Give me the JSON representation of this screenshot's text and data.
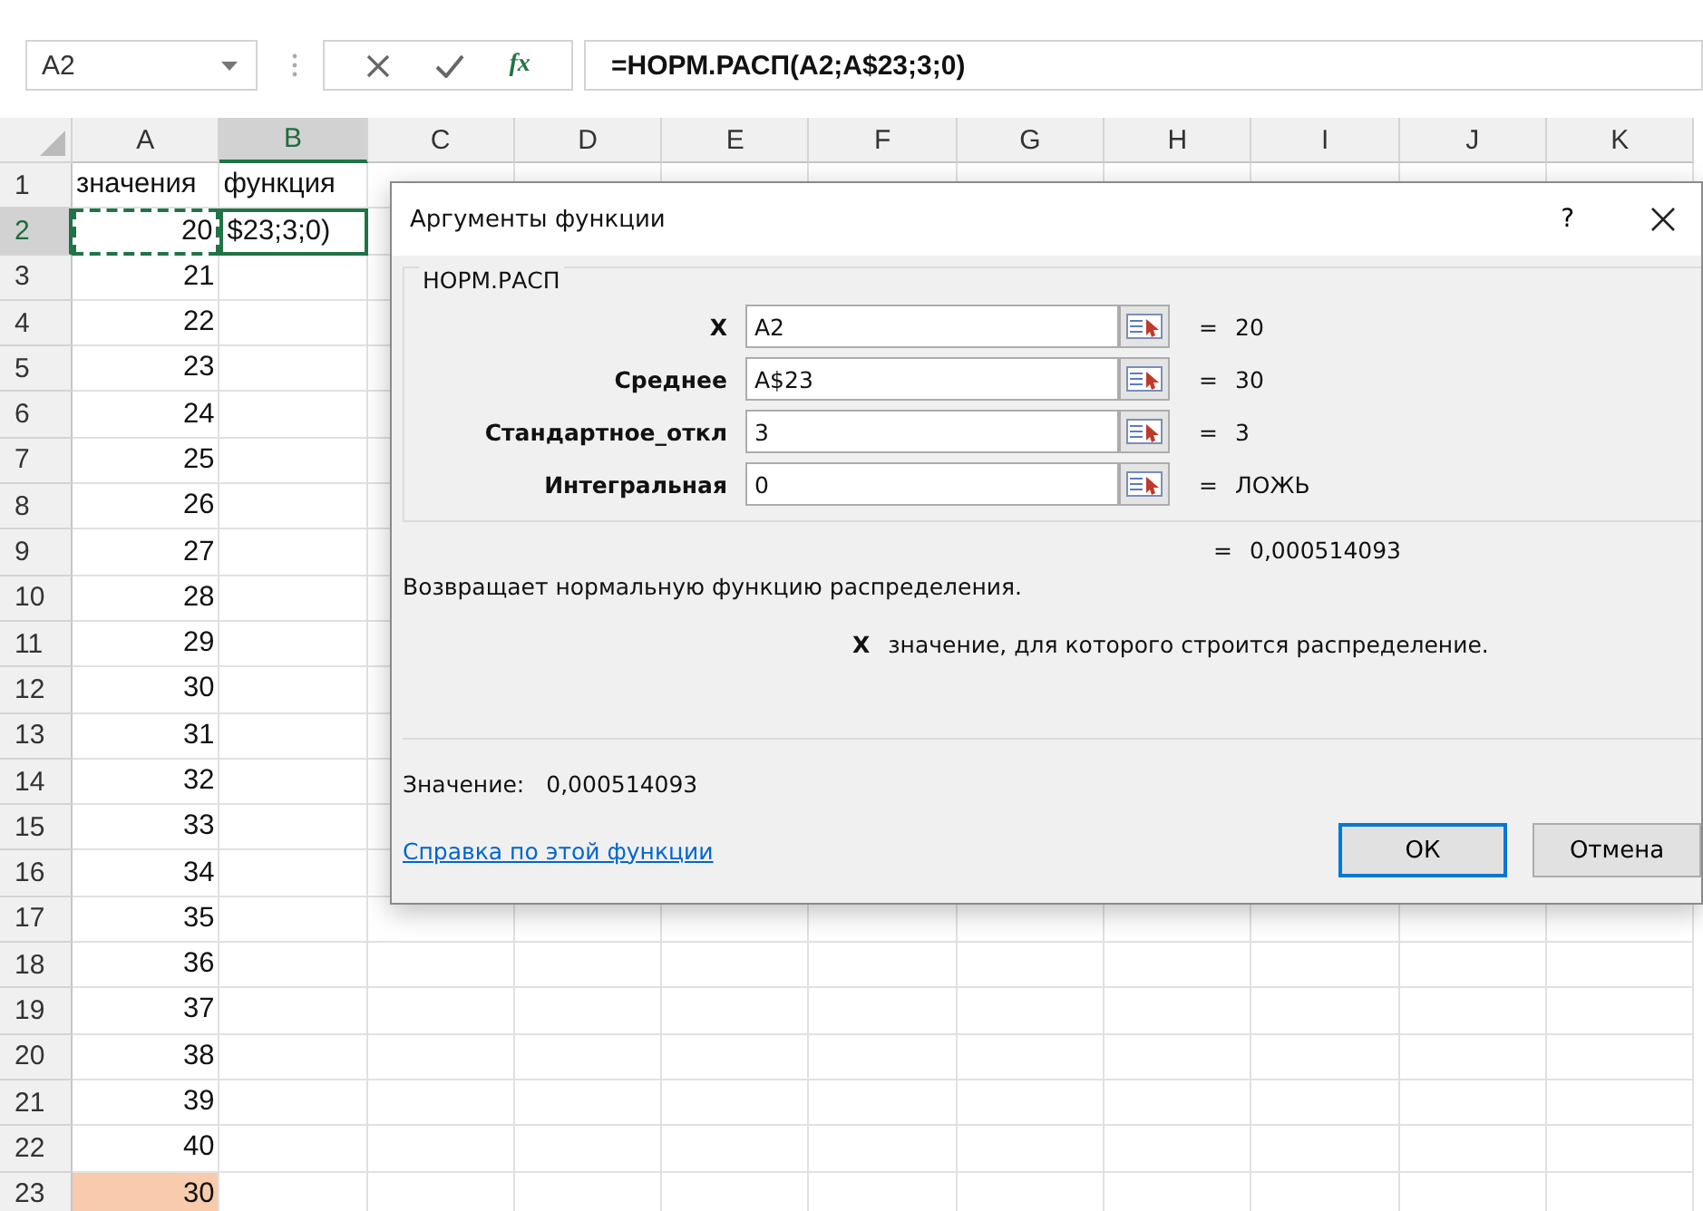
{
  "formula_bar": {
    "name_box": "A2",
    "fx": "fx",
    "formula": "=НОРМ.РАСП(A2;A$23;3;0)"
  },
  "columns": [
    {
      "label": "A",
      "selected": false
    },
    {
      "label": "B",
      "selected": true
    },
    {
      "label": "C",
      "selected": false
    },
    {
      "label": "D",
      "selected": false
    },
    {
      "label": "E",
      "selected": false
    },
    {
      "label": "F",
      "selected": false
    },
    {
      "label": "G",
      "selected": false
    },
    {
      "label": "H",
      "selected": false
    },
    {
      "label": "I",
      "selected": false
    },
    {
      "label": "J",
      "selected": false
    },
    {
      "label": "K",
      "selected": false
    }
  ],
  "rows": [
    {
      "number": "1",
      "selected": false,
      "a": "значения",
      "b": "функция",
      "a_referenced": false,
      "a_highlighted": false,
      "b_active": false
    },
    {
      "number": "2",
      "selected": true,
      "a": "20",
      "b": "$23;3;0)",
      "a_referenced": true,
      "a_highlighted": false,
      "b_active": true
    },
    {
      "number": "3",
      "selected": false,
      "a": "21",
      "a_referenced": false,
      "a_highlighted": false,
      "b_active": false
    },
    {
      "number": "4",
      "selected": false,
      "a": "22",
      "a_referenced": false,
      "a_highlighted": false,
      "b_active": false
    },
    {
      "number": "5",
      "selected": false,
      "a": "23",
      "a_referenced": false,
      "a_highlighted": false,
      "b_active": false
    },
    {
      "number": "6",
      "selected": false,
      "a": "24",
      "a_referenced": false,
      "a_highlighted": false,
      "b_active": false
    },
    {
      "number": "7",
      "selected": false,
      "a": "25",
      "a_referenced": false,
      "a_highlighted": false,
      "b_active": false
    },
    {
      "number": "8",
      "selected": false,
      "a": "26",
      "a_referenced": false,
      "a_highlighted": false,
      "b_active": false
    },
    {
      "number": "9",
      "selected": false,
      "a": "27",
      "a_referenced": false,
      "a_highlighted": false,
      "b_active": false
    },
    {
      "number": "10",
      "selected": false,
      "a": "28",
      "a_referenced": false,
      "a_highlighted": false,
      "b_active": false
    },
    {
      "number": "11",
      "selected": false,
      "a": "29",
      "a_referenced": false,
      "a_highlighted": false,
      "b_active": false
    },
    {
      "number": "12",
      "selected": false,
      "a": "30",
      "a_referenced": false,
      "a_highlighted": false,
      "b_active": false
    },
    {
      "number": "13",
      "selected": false,
      "a": "31",
      "a_referenced": false,
      "a_highlighted": false,
      "b_active": false
    },
    {
      "number": "14",
      "selected": false,
      "a": "32",
      "a_referenced": false,
      "a_highlighted": false,
      "b_active": false
    },
    {
      "number": "15",
      "selected": false,
      "a": "33",
      "a_referenced": false,
      "a_highlighted": false,
      "b_active": false
    },
    {
      "number": "16",
      "selected": false,
      "a": "34",
      "a_referenced": false,
      "a_highlighted": false,
      "b_active": false
    },
    {
      "number": "17",
      "selected": false,
      "a": "35",
      "a_referenced": false,
      "a_highlighted": false,
      "b_active": false
    },
    {
      "number": "18",
      "selected": false,
      "a": "36",
      "a_referenced": false,
      "a_highlighted": false,
      "b_active": false
    },
    {
      "number": "19",
      "selected": false,
      "a": "37",
      "a_referenced": false,
      "a_highlighted": false,
      "b_active": false
    },
    {
      "number": "20",
      "selected": false,
      "a": "38",
      "a_referenced": false,
      "a_highlighted": false,
      "b_active": false
    },
    {
      "number": "21",
      "selected": false,
      "a": "39",
      "a_referenced": false,
      "a_highlighted": false,
      "b_active": false
    },
    {
      "number": "22",
      "selected": false,
      "a": "40",
      "a_referenced": false,
      "a_highlighted": false,
      "b_active": false
    },
    {
      "number": "23",
      "selected": false,
      "a": "30",
      "a_referenced": false,
      "a_highlighted": true,
      "b_active": false
    }
  ],
  "dialog": {
    "title": "Аргументы функции",
    "help": "?",
    "function_name": "НОРМ.РАСП",
    "arguments": [
      {
        "label": "X",
        "value": "A2",
        "sign": "=",
        "result": "20"
      },
      {
        "label": "Среднее",
        "value": "A$23",
        "sign": "=",
        "result": "30"
      },
      {
        "label": "Стандартное_откл",
        "value": "3",
        "sign": "=",
        "result": "3"
      },
      {
        "label": "Интегральная",
        "value": "0",
        "sign": "=",
        "result": "ЛОЖЬ"
      }
    ],
    "result_sign": "=",
    "result": "0,000514093",
    "description": "Возвращает нормальную функцию распределения.",
    "argument_help": {
      "name": "X",
      "text": "значение, для которого строится распределение."
    },
    "value_label": "Значение:",
    "value": "0,000514093",
    "help_link": "Справка по этой функции",
    "buttons": [
      {
        "label": "ОК",
        "selected": true
      },
      {
        "label": "Отмена",
        "selected": false
      }
    ]
  }
}
